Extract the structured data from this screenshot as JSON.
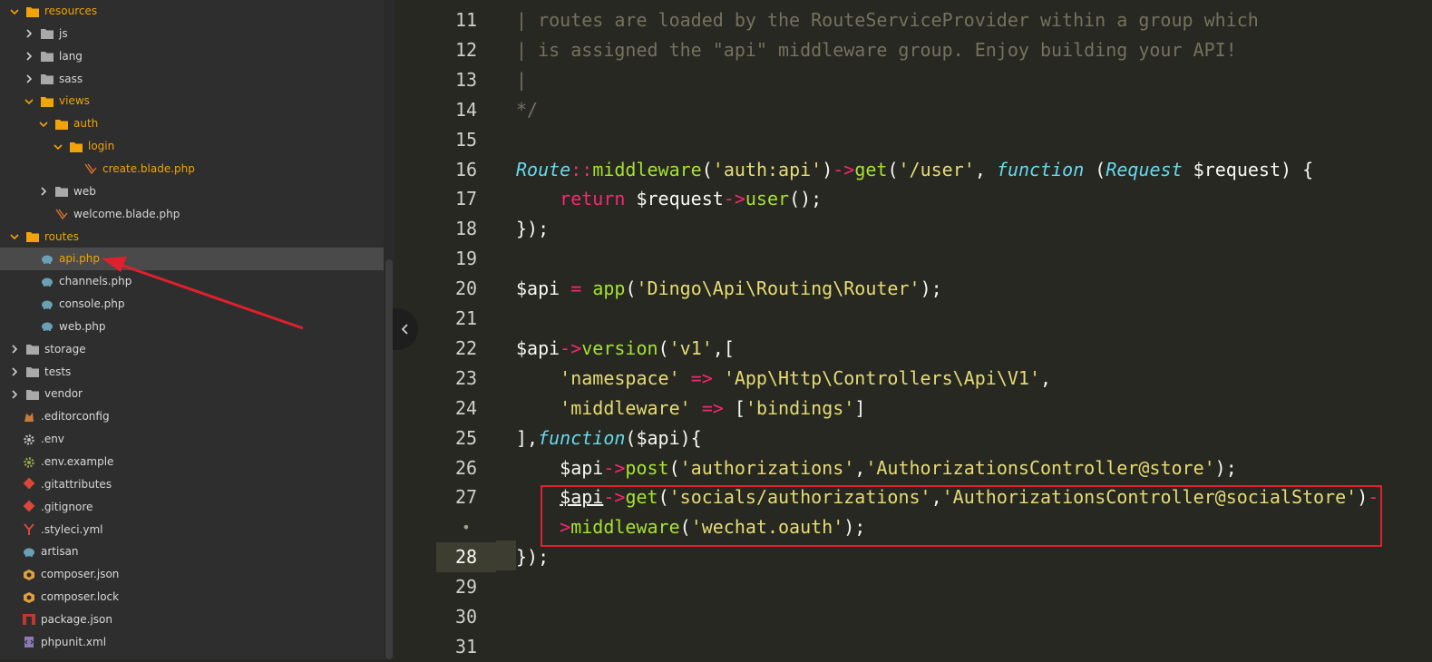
{
  "colors": {
    "sidebar_bg": "#2e2e2e",
    "editor_bg": "#272822",
    "folder_open": "#f0a30a",
    "folder_closed": "#a9a9a9",
    "keyword": "#f92672",
    "string": "#e6db74",
    "function": "#a6e22e",
    "type": "#66d9ef",
    "comment": "#75715e",
    "annotation": "#e0202c"
  },
  "tree": [
    {
      "label": "resources",
      "kind": "folder",
      "open": true,
      "depth": 0
    },
    {
      "label": "js",
      "kind": "folder",
      "open": false,
      "depth": 1
    },
    {
      "label": "lang",
      "kind": "folder",
      "open": false,
      "depth": 1
    },
    {
      "label": "sass",
      "kind": "folder",
      "open": false,
      "depth": 1
    },
    {
      "label": "views",
      "kind": "folder",
      "open": true,
      "depth": 1
    },
    {
      "label": "auth",
      "kind": "folder",
      "open": true,
      "depth": 2
    },
    {
      "label": "login",
      "kind": "folder",
      "open": true,
      "depth": 3
    },
    {
      "label": "create.blade.php",
      "kind": "blade",
      "open": true,
      "depth": 4
    },
    {
      "label": "web",
      "kind": "folder",
      "open": false,
      "depth": 2
    },
    {
      "label": "welcome.blade.php",
      "kind": "blade",
      "open": false,
      "depth": 2
    },
    {
      "label": "routes",
      "kind": "folder",
      "open": true,
      "depth": 0
    },
    {
      "label": "api.php",
      "kind": "php",
      "open": true,
      "depth": 1,
      "selected": true
    },
    {
      "label": "channels.php",
      "kind": "php",
      "open": false,
      "depth": 1
    },
    {
      "label": "console.php",
      "kind": "php",
      "open": false,
      "depth": 1
    },
    {
      "label": "web.php",
      "kind": "php",
      "open": false,
      "depth": 1
    },
    {
      "label": "storage",
      "kind": "folder",
      "open": false,
      "depth": 0
    },
    {
      "label": "tests",
      "kind": "folder",
      "open": false,
      "depth": 0
    },
    {
      "label": "vendor",
      "kind": "folder",
      "open": false,
      "depth": 0
    },
    {
      "label": ".editorconfig",
      "kind": "editorconfig",
      "open": false,
      "depth": 0,
      "file": true
    },
    {
      "label": ".env",
      "kind": "gear",
      "open": false,
      "depth": 0,
      "file": true
    },
    {
      "label": ".env.example",
      "kind": "gear-green",
      "open": false,
      "depth": 0,
      "file": true
    },
    {
      "label": ".gitattributes",
      "kind": "git",
      "open": false,
      "depth": 0,
      "file": true
    },
    {
      "label": ".gitignore",
      "kind": "git",
      "open": false,
      "depth": 0,
      "file": true
    },
    {
      "label": ".styleci.yml",
      "kind": "yml",
      "open": false,
      "depth": 0,
      "file": true
    },
    {
      "label": "artisan",
      "kind": "php",
      "open": false,
      "depth": 0,
      "file": true
    },
    {
      "label": "composer.json",
      "kind": "composer",
      "open": false,
      "depth": 0,
      "file": true
    },
    {
      "label": "composer.lock",
      "kind": "composer",
      "open": false,
      "depth": 0,
      "file": true
    },
    {
      "label": "package.json",
      "kind": "npm",
      "open": false,
      "depth": 0,
      "file": true
    },
    {
      "label": "phpunit.xml",
      "kind": "xml",
      "open": false,
      "depth": 0,
      "file": true
    }
  ],
  "line_numbers": [
    "11",
    "12",
    "13",
    "14",
    "15",
    "16",
    "17",
    "18",
    "19",
    "20",
    "21",
    "22",
    "23",
    "24",
    "25",
    "26",
    "27",
    "•",
    "28",
    "29",
    "30",
    "31"
  ],
  "active_line": "28",
  "code": [
    [
      [
        "c",
        "| routes are loaded by the RouteServiceProvider within a group which"
      ]
    ],
    [
      [
        "c",
        "| is assigned the \"api\" middleware group. Enjoy building your API!"
      ]
    ],
    [
      [
        "c",
        "|"
      ]
    ],
    [
      [
        "c",
        "*/"
      ]
    ],
    [],
    [
      [
        "t",
        "Route"
      ],
      [
        "k",
        "::"
      ],
      [
        "f",
        "middleware"
      ],
      [
        "p",
        "("
      ],
      [
        "s",
        "'auth:api'"
      ],
      [
        "p",
        ")"
      ],
      [
        "k",
        "->"
      ],
      [
        "f",
        "get"
      ],
      [
        "p",
        "("
      ],
      [
        "s",
        "'/user'"
      ],
      [
        "p",
        ", "
      ],
      [
        "t",
        "function"
      ],
      [
        "p",
        " ("
      ],
      [
        "t",
        "Request"
      ],
      [
        "p",
        " $request) {"
      ]
    ],
    [
      [
        "p",
        "    "
      ],
      [
        "k",
        "return"
      ],
      [
        "p",
        " $request"
      ],
      [
        "k",
        "->"
      ],
      [
        "f",
        "user"
      ],
      [
        "p",
        "();"
      ]
    ],
    [
      [
        "p",
        "});"
      ]
    ],
    [],
    [
      [
        "p",
        "$api "
      ],
      [
        "k",
        "="
      ],
      [
        "p",
        " "
      ],
      [
        "f",
        "app"
      ],
      [
        "p",
        "("
      ],
      [
        "s",
        "'Dingo\\Api\\Routing\\Router'"
      ],
      [
        "p",
        ");"
      ]
    ],
    [],
    [
      [
        "p",
        "$api"
      ],
      [
        "k",
        "->"
      ],
      [
        "f",
        "version"
      ],
      [
        "p",
        "("
      ],
      [
        "s",
        "'v1'"
      ],
      [
        "p",
        ",["
      ]
    ],
    [
      [
        "p",
        "    "
      ],
      [
        "s",
        "'namespace'"
      ],
      [
        "p",
        " "
      ],
      [
        "k",
        "=>"
      ],
      [
        "p",
        " "
      ],
      [
        "s",
        "'App\\Http\\Controllers\\Api\\V1'"
      ],
      [
        "p",
        ","
      ]
    ],
    [
      [
        "p",
        "    "
      ],
      [
        "s",
        "'middleware'"
      ],
      [
        "p",
        " "
      ],
      [
        "k",
        "=>"
      ],
      [
        "p",
        " ["
      ],
      [
        "s",
        "'bindings'"
      ],
      [
        "p",
        "]"
      ]
    ],
    [
      [
        "p",
        "],"
      ],
      [
        "t",
        "function"
      ],
      [
        "p",
        "($api){"
      ]
    ],
    [
      [
        "p",
        "    $api"
      ],
      [
        "k",
        "->"
      ],
      [
        "f",
        "post"
      ],
      [
        "p",
        "("
      ],
      [
        "s",
        "'authorizations'"
      ],
      [
        "p",
        ","
      ],
      [
        "s",
        "'AuthorizationsController@store'"
      ],
      [
        "p",
        ");"
      ]
    ],
    [
      [
        "p",
        "    "
      ],
      [
        "u",
        "$api"
      ],
      [
        "k",
        "->"
      ],
      [
        "f",
        "get"
      ],
      [
        "p",
        "("
      ],
      [
        "s",
        "'socials/authorizations'"
      ],
      [
        "p",
        ","
      ],
      [
        "s",
        "'AuthorizationsController@socialStore'"
      ],
      [
        "p",
        ")"
      ],
      [
        "k",
        "-"
      ]
    ],
    [
      [
        "p",
        "    "
      ],
      [
        "k",
        ">"
      ],
      [
        "f",
        "middleware"
      ],
      [
        "p",
        "("
      ],
      [
        "s",
        "'wechat.oauth'"
      ],
      [
        "p",
        ");"
      ]
    ],
    [
      [
        "p",
        "});"
      ]
    ],
    [],
    [],
    []
  ]
}
